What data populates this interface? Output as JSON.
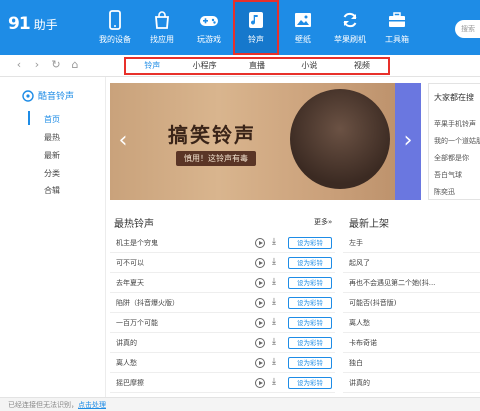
{
  "app": {
    "logo_mark": "91",
    "logo_name": "助手"
  },
  "nav": [
    {
      "label": "我的设备",
      "icon": "phone-icon"
    },
    {
      "label": "找应用",
      "icon": "bag-icon"
    },
    {
      "label": "玩游戏",
      "icon": "gamepad-icon"
    },
    {
      "label": "铃声",
      "icon": "music-note-icon",
      "active": true
    },
    {
      "label": "壁纸",
      "icon": "image-icon"
    },
    {
      "label": "苹果刷机",
      "icon": "refresh-icon"
    },
    {
      "label": "工具箱",
      "icon": "toolbox-icon"
    }
  ],
  "search": {
    "placeholder": "搜索"
  },
  "subtabs": [
    {
      "label": "铃声",
      "active": true
    },
    {
      "label": "小程序"
    },
    {
      "label": "直播"
    },
    {
      "label": "小说"
    },
    {
      "label": "视频"
    }
  ],
  "sidebar": {
    "title": "酷音铃声",
    "items": [
      "首页",
      "最热",
      "最新",
      "分类",
      "合辑"
    ]
  },
  "banner": {
    "title": "搞笑铃声",
    "subtitle": "慎用！这铃声有毒"
  },
  "right_panel": {
    "title": "大家都在搜",
    "items": [
      "苹果手机铃声",
      "我的一个道姑朋",
      "全部都是你",
      "吾白气球",
      "陈奕迅"
    ]
  },
  "hot": {
    "title": "最热铃声",
    "more": "更多»",
    "set_label": "设为彩铃",
    "items": [
      "机主是个穷鬼",
      "可不可以",
      "去年夏天",
      "陷阱（抖音爆火版）",
      "一百万个可能",
      "讲真的",
      "离人愁",
      "摇巴摩擦"
    ]
  },
  "newest": {
    "title": "最新上架",
    "items": [
      "左手",
      "起风了",
      "再也不会遇见第二个她(抖...",
      "可能否(抖音版)",
      "离人愁",
      "卡布奇诺",
      "独白",
      "讲真的"
    ]
  },
  "status": {
    "text": "已经连接但无法识别，",
    "link": "点击处理"
  }
}
